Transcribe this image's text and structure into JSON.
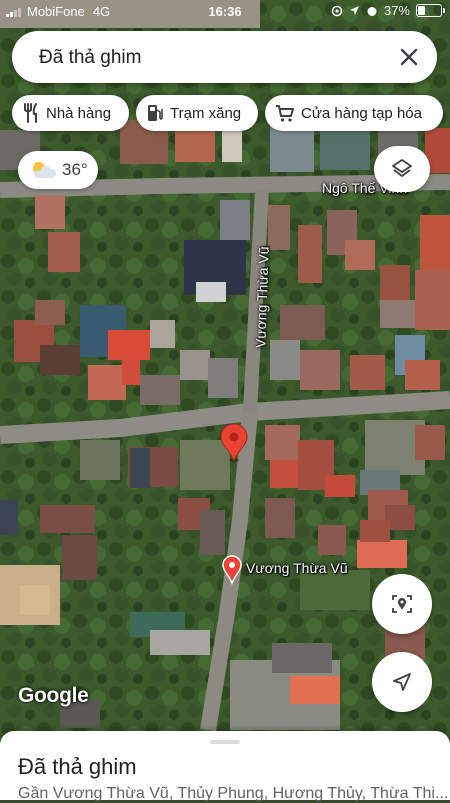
{
  "status_bar": {
    "carrier": "MobiFone",
    "network": "4G",
    "time": "16:36",
    "battery": "37%",
    "battery_level": 0.37
  },
  "search": {
    "query": "Đã thả ghim"
  },
  "chips": [
    {
      "label": "Nhà hàng",
      "icon": "restaurant-icon"
    },
    {
      "label": "Trạm xăng",
      "icon": "gas-station-icon"
    },
    {
      "label": "Cửa hàng tạp hóa",
      "icon": "shopping-cart-icon"
    }
  ],
  "weather": {
    "temperature": "36°",
    "icon": "partly-cloudy-icon"
  },
  "map": {
    "road_labels": [
      "Ngô Thế Vinh",
      "Vương Thừa Vũ"
    ],
    "place_label": "Vương Thừa Vũ",
    "attribution": "Google",
    "accent_color": "#ea4335"
  },
  "bottom_sheet": {
    "title": "Đã thả ghim",
    "address": "Gần Vương Thừa Vũ, Thủy Phung, Hương Thủy, Thừa Thi..."
  }
}
